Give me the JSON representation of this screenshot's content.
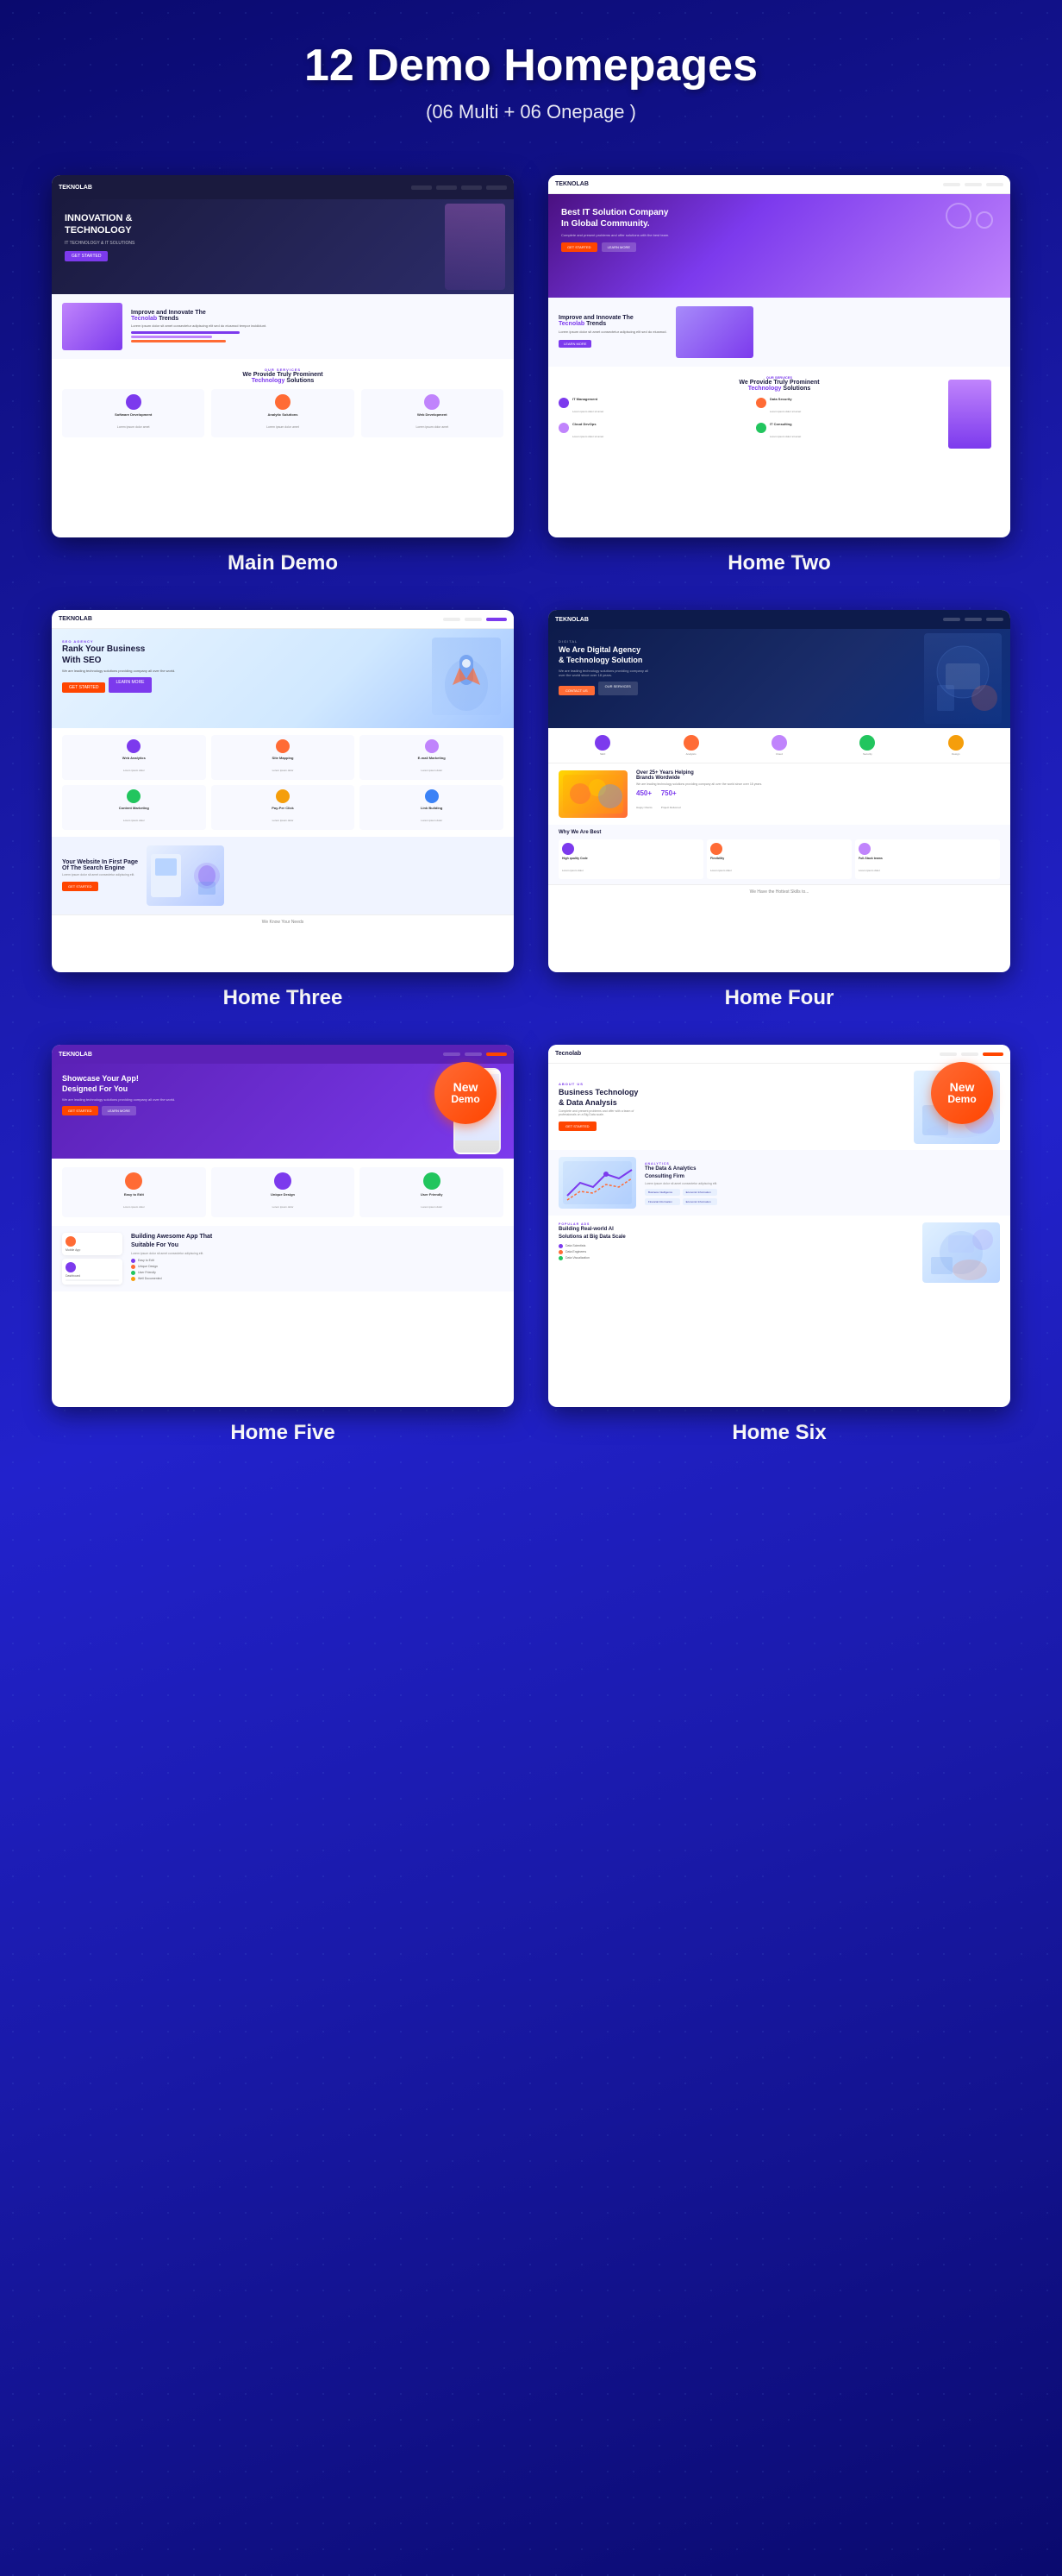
{
  "header": {
    "title": "12 Demo Homepages",
    "subtitle": "(06 Multi + 06 Onepage )"
  },
  "demos": [
    {
      "id": "main-demo",
      "label": "Main Demo",
      "isNew": false,
      "hero": {
        "title": "INNOVATION &\nTECHNOLOGY"
      },
      "section": {
        "heading": "Improve and Innovate The",
        "brand": "Tecnolab",
        "heading2": "Trends"
      },
      "services": {
        "title": "We Provide Truly Prominent",
        "brand": "Technology",
        "title2": "Solutions",
        "items": [
          "Software Development",
          "Analytic Solutions",
          "Web Development"
        ]
      }
    },
    {
      "id": "home-two",
      "label": "Home Two",
      "isNew": false,
      "hero": {
        "title": "Best IT Solution Company\nIn Global Community."
      },
      "section": {
        "heading": "Improve and Innovate The",
        "brand": "Tecnolab",
        "heading2": "Trends"
      },
      "services": {
        "title": "We Provide Truly Prominent",
        "brand": "Technology",
        "title2": "Solutions",
        "items": [
          "IT Management",
          "Data Security",
          "Cloud DevOps",
          "IT Consulting"
        ]
      }
    },
    {
      "id": "home-three",
      "label": "Home Three",
      "isNew": false,
      "hero": {
        "title": "Rank Your Business\nWith SEO"
      },
      "services": {
        "items": [
          "Web Analytics",
          "Site Mapping",
          "E-mail Marketing",
          "Content Marketing",
          "Pay-Per Click",
          "Link Building"
        ]
      },
      "cta": {
        "title": "Your Website In First Page\nOf The Search Engine"
      },
      "footer": "We Know Your Needs"
    },
    {
      "id": "home-four",
      "label": "Home Four",
      "isNew": false,
      "hero": {
        "eyebrow": "DIGITAL",
        "title": "We Are Digital Agency\n& Technology Solution",
        "desc": "We are leading technology solutions providing company all\nover the world since over 18 years."
      },
      "stats": {
        "title": "Over 25+ Years Helping\nBrands Wordwide",
        "numbers": [
          "450+",
          "750+"
        ],
        "labels": [
          "Happy Clients",
          "Project Delivered"
        ]
      },
      "why": {
        "title": "Why We Are Best",
        "items": [
          "High quality Code",
          "Flexibility",
          "Full-Stack teams"
        ]
      }
    },
    {
      "id": "home-five",
      "label": "Home Five",
      "isNew": true,
      "badge": {
        "new": "New",
        "demo": "Demo"
      },
      "hero": {
        "title": "Showcase Your App!\nDesigned For You"
      },
      "features": {
        "items": [
          "Easy to Edit",
          "Unique Design",
          "User Friendly"
        ]
      },
      "appSection": {
        "title": "Building Awesome App That\nSuitable For You",
        "checklist": [
          "Easy to Edit",
          "Unique Design",
          "User Friendly",
          "Well Documented"
        ]
      }
    },
    {
      "id": "home-six",
      "label": "Home Six",
      "isNew": true,
      "badge": {
        "new": "New",
        "demo": "Demo"
      },
      "hero": {
        "eyebrow": "ABOUT US",
        "title": "Business Technology\n& Data Analysis",
        "desc": "Complete and present problems and offer with a team of\nprofessionals on a Big Data scale."
      },
      "dataSection": {
        "title": "The Data & Analytics\nConsulting Firm",
        "tags": [
          "Business Intelligence",
          "Economic Information",
          "Financial Information",
          "Economic Information"
        ]
      },
      "aiSection": {
        "title": "Building Real-world AI\nSolutions at Big Data Scale",
        "roles": [
          "Data Scientists",
          "Data Engineers",
          "Data Visualization"
        ]
      }
    }
  ],
  "colors": {
    "accent_purple": "#7c3aed",
    "accent_orange": "#ff4500",
    "accent_pink": "#c084fc",
    "dark_navy": "#1a1a3e",
    "bg_blue": "#1a1aaa",
    "text_white": "#ffffff"
  }
}
